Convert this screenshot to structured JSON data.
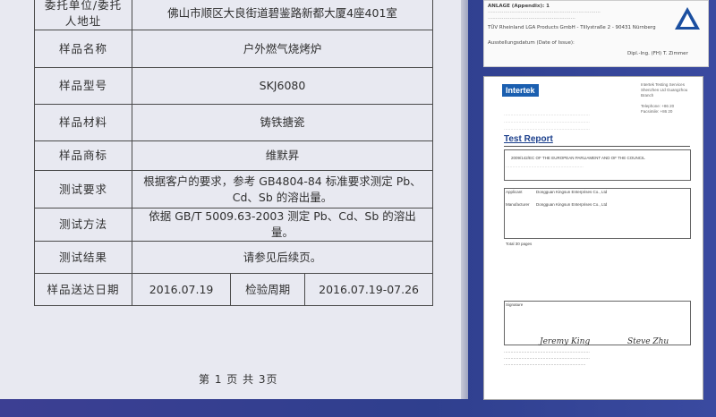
{
  "document": {
    "rows": [
      {
        "key": "委托单位/委托人地址",
        "value": "佛山市顺区大良街道碧鉴路新都大厦4座401室"
      },
      {
        "key": "样品名称",
        "value": "户外燃气烧烤炉"
      },
      {
        "key": "样品型号",
        "value": "SKJ6080"
      },
      {
        "key": "样品材料",
        "value": "铸铁搪瓷"
      },
      {
        "key": "样品商标",
        "value": "维默昇"
      },
      {
        "key": "测试要求",
        "value": "根据客户的要求，参考 GB4804-84 标准要求测定 Pb、Cd、Sb 的溶出量。"
      },
      {
        "key": "测试方法",
        "value": "依据 GB/T 5009.63-2003 测定 Pb、Cd、Sb 的溶出量。"
      },
      {
        "key": "测试结果",
        "value": "请参见后续页。"
      }
    ],
    "send_date_key": "样品送达日期",
    "send_date": "2016.07.19",
    "period_key": "检验周期",
    "period": "2016.07.19-07.26",
    "footer": "第 1 页 共 3页"
  },
  "certificate": {
    "header": "ANLAGE (Appendix): 1",
    "issuer": "TÜV Rheinland LGA Products GmbH - Tillystraße 2 - 90431 Nürnberg",
    "date_label": "Ausstellungsdatum (Date of Issue):",
    "signature_label": "Dipl.-Ing. (FH) T. Zimmer"
  },
  "report": {
    "logo": "Intertek",
    "title": "Test Report",
    "directive": "2009/142/EC OF THE EUROPEAN PARLIAMENT AND OF THE COUNCIL",
    "applicant_label": "Applicant",
    "applicant": "Dongguan Kingsun Enterprises Co., Ltd",
    "manufacturer_label": "Manufacturer",
    "manufacturer": "Dongguan Kingsun Enterprises Co., Ltd",
    "total_pages": "Total 30 pages",
    "signature_label": "Signature",
    "sig1": "Jeremy King",
    "sig2": "Steve Zhu"
  },
  "colors": {
    "page_bg": "#3a3f8c",
    "report_blue": "#1b5fb0"
  }
}
